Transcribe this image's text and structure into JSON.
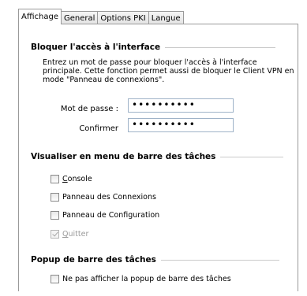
{
  "tabs": [
    {
      "label": "Affichage",
      "active": true
    },
    {
      "label": "General",
      "active": false
    },
    {
      "label": "Options PKI",
      "active": false
    },
    {
      "label": "Langue",
      "active": false
    }
  ],
  "lock_group": {
    "title": "Bloquer l'accès à l'interface",
    "description": "Entrez un mot de passe pour bloquer l'accès à l'interface principale. Cette fonction permet aussi de bloquer le Client VPN en mode \"Panneau de connexions\".",
    "password_label": "Mot de passe :",
    "password_value": "••••••••••",
    "confirm_label": "Confirmer",
    "confirm_value": "••••••••••"
  },
  "taskbar_group": {
    "title": "Visualiser en menu de barre des tâches",
    "items": [
      {
        "first": "C",
        "rest": "onsole",
        "checked": false,
        "disabled": false
      },
      {
        "first": "",
        "rest": "Panneau des Connexions",
        "checked": false,
        "disabled": false
      },
      {
        "first": "",
        "rest": "Panneau de Configuration",
        "checked": false,
        "disabled": false
      },
      {
        "first": "Q",
        "rest": "uitter",
        "checked": true,
        "disabled": true
      }
    ]
  },
  "popup_group": {
    "title": "Popup de barre des tâches",
    "item_label": "Ne pas afficher la popup de barre des tâches",
    "item_checked": false
  }
}
